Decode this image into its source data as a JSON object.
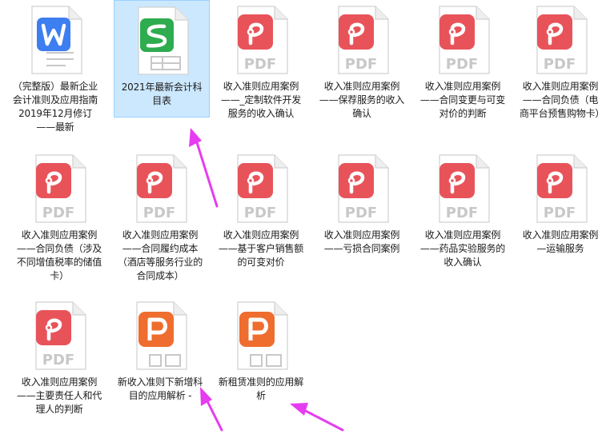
{
  "accent": "#e63cf0",
  "files": [
    {
      "type": "wps-writer",
      "label": "（完整版）最新企业会计准则及应用指南2019年12月修订——最新",
      "selected": false
    },
    {
      "type": "wps-sheet",
      "label": "2021年最新会计科目表",
      "selected": true
    },
    {
      "type": "pdf",
      "badge": "PDF",
      "label": "收入准则应用案例——_定制软件开发服务的收入确认",
      "selected": false
    },
    {
      "type": "pdf",
      "badge": "PDF",
      "label": "收入准则应用案例——保荐服务的收入确认",
      "selected": false
    },
    {
      "type": "pdf",
      "badge": "PDF",
      "label": "收入准则应用案例——合同变更与可变对价的判断",
      "selected": false
    },
    {
      "type": "pdf",
      "badge": "PDF",
      "label": "收入准则应用案例——合同负债（电商平台预售购物卡）",
      "selected": false
    },
    {
      "type": "pdf",
      "badge": "PDF",
      "label": "收入准则应用案例——合同负债（涉及不同增值税率的储值卡）",
      "selected": false
    },
    {
      "type": "pdf",
      "badge": "PDF",
      "label": "收入准则应用案例——合同履约成本（酒店等服务行业的合同成本）",
      "selected": false
    },
    {
      "type": "pdf",
      "badge": "PDF",
      "label": "收入准则应用案例——基于客户销售额的可变对价",
      "selected": false
    },
    {
      "type": "pdf",
      "badge": "PDF",
      "label": "收入准则应用案例——亏损合同案例",
      "selected": false
    },
    {
      "type": "pdf",
      "badge": "PDF",
      "label": "收入准则应用案例——药品实验服务的收入确认",
      "selected": false
    },
    {
      "type": "pdf",
      "badge": "PDF",
      "label": "收入准则应用案例—运输服务",
      "selected": false
    },
    {
      "type": "pdf",
      "badge": "PDF",
      "label": "收入准则应用案例——主要责任人和代理人的判断",
      "selected": false
    },
    {
      "type": "wps-presentation",
      "label": "新收入准则下新增科目的应用解析 -",
      "selected": false
    },
    {
      "type": "wps-presentation",
      "label": "新租赁准则的应用解析",
      "selected": false
    }
  ]
}
